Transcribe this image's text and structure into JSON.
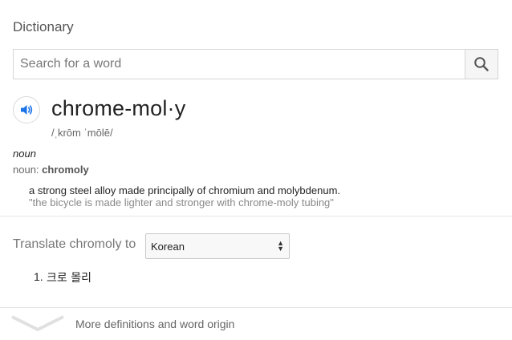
{
  "heading": "Dictionary",
  "search": {
    "placeholder": "Search for a word",
    "icon": "search-icon"
  },
  "entry": {
    "word": "chrome-mol·y",
    "phonetic": "/ˌkrōm ˈmōlē/",
    "part_of_speech": "noun",
    "noun_label": "noun:",
    "noun_value": "chromoly",
    "definition": "a strong steel alloy made principally of chromium and molybdenum.",
    "example": "\"the bicycle is made lighter and stronger with chrome-moly tubing\"",
    "audio_icon": "speaker-icon"
  },
  "translate": {
    "label": "Translate chromoly to",
    "selected_language": "Korean",
    "results": [
      {
        "number": "1.",
        "text": "크로 몰리"
      }
    ]
  },
  "more": {
    "label": "More definitions and word origin",
    "icon": "chevron-down-icon"
  },
  "colors": {
    "accent": "#1a73e8",
    "divider": "#e6e6e6",
    "muted": "#777777"
  }
}
